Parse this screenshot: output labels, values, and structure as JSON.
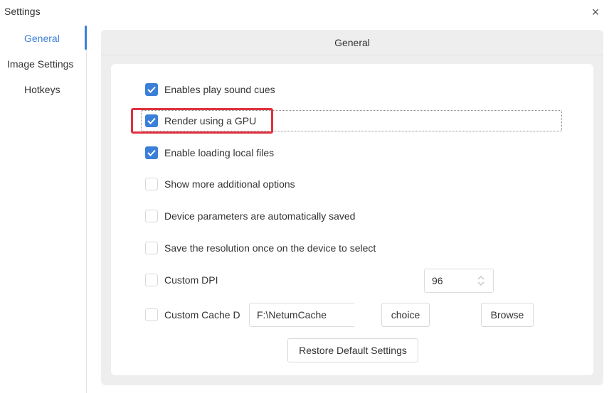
{
  "window": {
    "title": "Settings",
    "close_glyph": "×"
  },
  "sidebar": {
    "items": [
      {
        "label": "General",
        "active": true
      },
      {
        "label": "Image Settings",
        "active": false
      },
      {
        "label": "Hotkeys",
        "active": false
      }
    ]
  },
  "panel": {
    "header": "General",
    "options": [
      {
        "label": "Enables play sound cues",
        "checked": true
      },
      {
        "label": "Render using a GPU",
        "checked": true
      },
      {
        "label": "Enable loading local files",
        "checked": true
      },
      {
        "label": "Show more additional options",
        "checked": false
      },
      {
        "label": "Device parameters are automatically saved",
        "checked": false
      },
      {
        "label": "Save the resolution once on the device to select",
        "checked": false
      },
      {
        "label": "Custom DPI",
        "checked": false
      },
      {
        "label": "Custom Cache D",
        "checked": false
      }
    ],
    "dpi_value": "96",
    "cache_path": "F:\\NetumCache",
    "choice_label": "choice",
    "browse_label": "Browse",
    "restore_label": "Restore Default Settings"
  },
  "colors": {
    "accent": "#3b7fd9",
    "highlight": "#e0313f",
    "panel_bg": "#eeeeee"
  },
  "icons": {
    "close": "close-icon",
    "checkmark": "checkmark-icon",
    "spinner": "spinner-arrows-icon"
  }
}
